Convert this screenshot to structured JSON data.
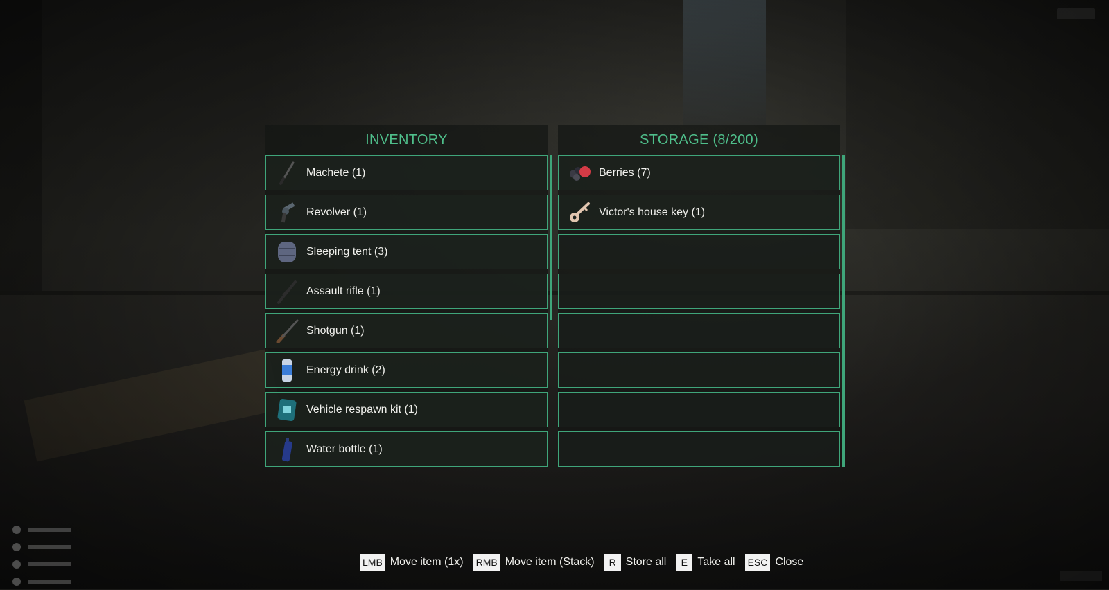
{
  "inventory": {
    "title": "INVENTORY",
    "items": [
      {
        "label": "Machete (1)",
        "icon": "machete-icon"
      },
      {
        "label": "Revolver (1)",
        "icon": "revolver-icon"
      },
      {
        "label": "Sleeping tent (3)",
        "icon": "sleeping-tent-icon"
      },
      {
        "label": "Assault rifle (1)",
        "icon": "assault-rifle-icon"
      },
      {
        "label": "Shotgun (1)",
        "icon": "shotgun-icon"
      },
      {
        "label": "Energy drink (2)",
        "icon": "energy-drink-icon"
      },
      {
        "label": "Vehicle respawn kit (1)",
        "icon": "vehicle-respawn-kit-icon"
      },
      {
        "label": "Water bottle (1)",
        "icon": "water-bottle-icon"
      }
    ]
  },
  "storage": {
    "title": "STORAGE (8/200)",
    "items": [
      {
        "label": "Berries (7)",
        "icon": "berries-icon"
      },
      {
        "label": "Victor's house key (1)",
        "icon": "key-icon"
      },
      {
        "label": ""
      },
      {
        "label": ""
      },
      {
        "label": ""
      },
      {
        "label": ""
      },
      {
        "label": ""
      },
      {
        "label": ""
      }
    ]
  },
  "hints": [
    {
      "key": "LMB",
      "label": "Move item (1x)"
    },
    {
      "key": "RMB",
      "label": "Move item (Stack)"
    },
    {
      "key": "R",
      "label": "Store all"
    },
    {
      "key": "E",
      "label": "Take all"
    },
    {
      "key": "ESC",
      "label": "Close"
    }
  ],
  "colors": {
    "accent": "#4fbf8b",
    "border": "#3fa57a",
    "text": "#f0f0ec"
  }
}
